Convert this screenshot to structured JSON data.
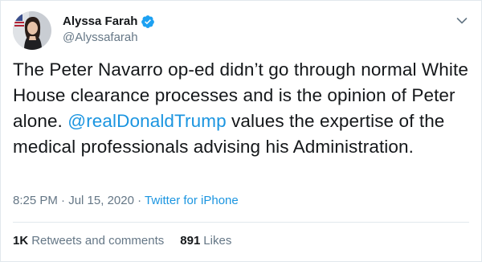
{
  "author": {
    "display_name": "Alyssa Farah",
    "handle": "@Alyssafarah",
    "verified": true
  },
  "tweet": {
    "text_before_mention": "The Peter Navarro op-ed didn’t go through normal White House clearance processes and is the opinion of Peter alone. ",
    "mention": "@realDonaldTrump",
    "text_after_mention": " values the expertise of the medical professionals advising his Administration."
  },
  "meta": {
    "time": "8:25 PM",
    "separator1": " · ",
    "date": "Jul 15, 2020",
    "separator2": " · ",
    "source": "Twitter for iPhone"
  },
  "stats": {
    "retweets_count": "1K",
    "retweets_label": "Retweets and comments",
    "likes_count": "891",
    "likes_label": "Likes"
  },
  "colors": {
    "link": "#1b95e0",
    "secondary": "#657786",
    "text": "#14171a",
    "border": "#e1e8ed"
  }
}
